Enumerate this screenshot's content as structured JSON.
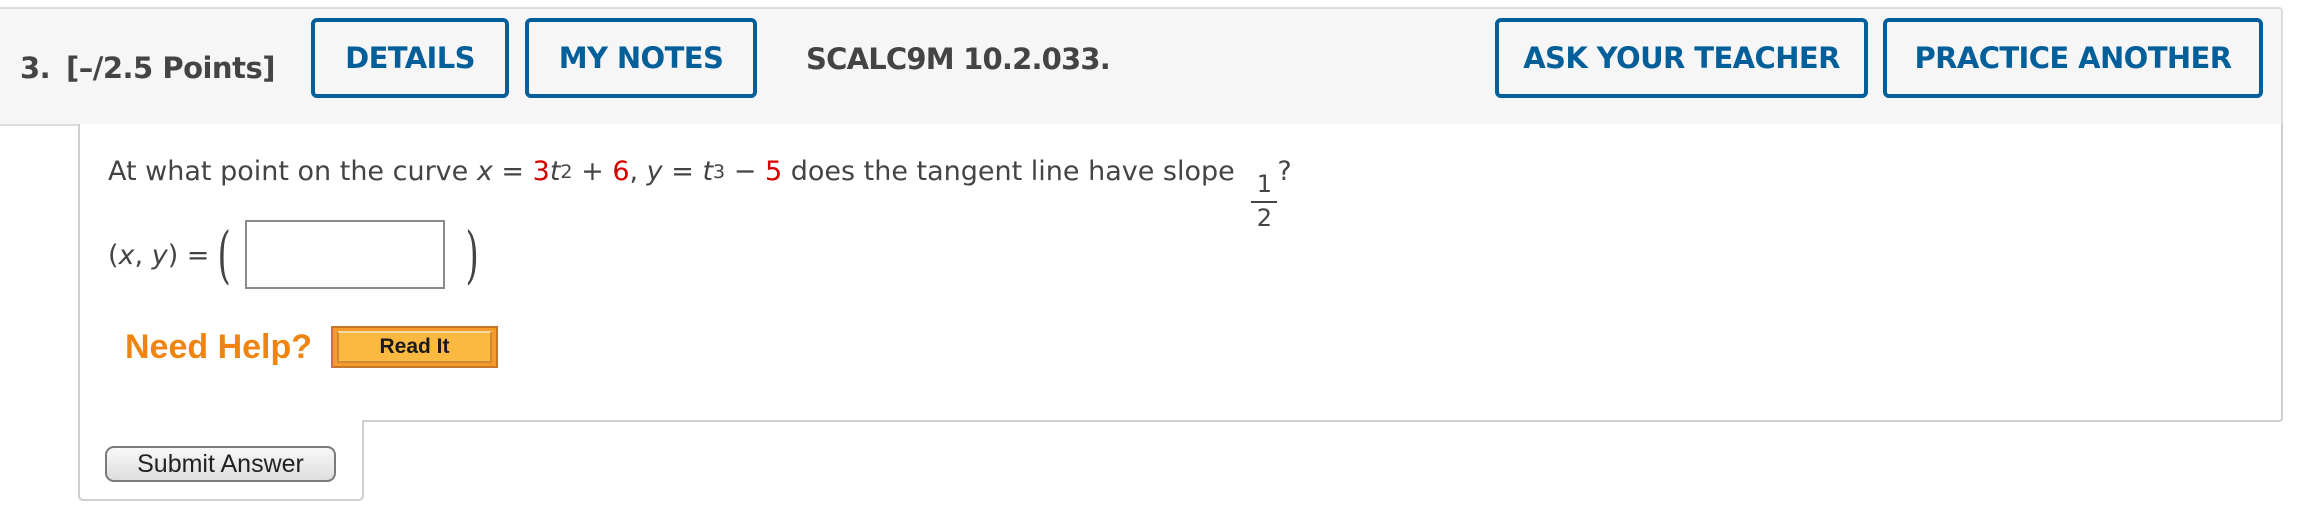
{
  "header": {
    "question_number": "3.",
    "points": "[–/2.5 Points]",
    "buttons": {
      "details": "DETAILS",
      "my_notes": "MY NOTES",
      "ask_teacher": "ASK YOUR TEACHER",
      "practice_another": "PRACTICE ANOTHER"
    },
    "question_code": "SCALC9M 10.2.033."
  },
  "question": {
    "prefix": "At what point on the curve ",
    "x_var": "x",
    "eq1": " = ",
    "x_coef": "3",
    "t1": "t",
    "exp1": "2",
    "plus": " + ",
    "x_const": "6",
    "comma": ", ",
    "y_var": "y",
    "eq2": " = ",
    "t2": "t",
    "exp2": "3",
    "minus": " − ",
    "y_const": "5",
    "suffix": " does the tangent line have slope ",
    "slope_numerator": "1",
    "slope_denominator": "2",
    "question_mark": "?"
  },
  "answer": {
    "label_open": "(",
    "label_x": "x",
    "label_comma": ", ",
    "label_y": "y",
    "label_close": ") =",
    "paren_left": "(",
    "paren_right": ")",
    "value": "",
    "placeholder": ""
  },
  "help": {
    "need_help": "Need Help?",
    "read_it": "Read It"
  },
  "submit": {
    "label": "Submit Answer"
  },
  "colors": {
    "accent_blue": "#035f99",
    "highlight_red": "#d40000",
    "help_orange": "#ef8510"
  }
}
